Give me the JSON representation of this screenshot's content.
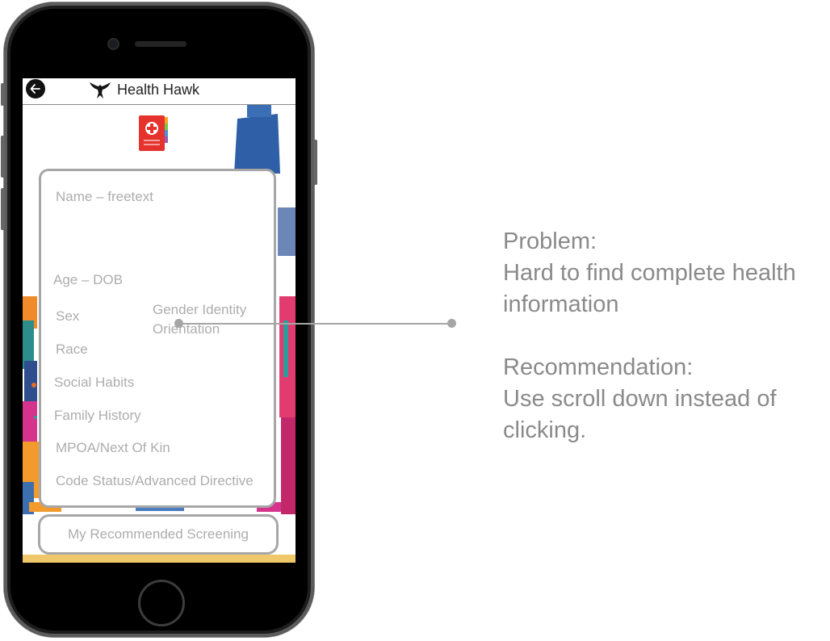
{
  "app": {
    "title": "Health Hawk"
  },
  "icons": {
    "back": "back-arrow-icon",
    "logo": "hawk-logo-icon",
    "record": "medical-record-icon"
  },
  "form": {
    "name": "Name – freetext",
    "age": "Age – DOB",
    "sex": "Sex",
    "gender_identity": "Gender Identity",
    "orientation": "Orientation",
    "race": "Race",
    "social_habits": "Social Habits",
    "family_history": "Family History",
    "mpoa": "MPOA/Next Of Kin",
    "code_status": "Code Status/Advanced Directive"
  },
  "screening_button": "My Recommended Screening",
  "annotation": {
    "problem_heading": "Problem:",
    "problem_line1": "Hard to find complete health",
    "problem_line2": "information",
    "recommendation_heading": "Recommendation:",
    "recommendation_line1": "Use scroll down instead of",
    "recommendation_line2": "clicking."
  },
  "colors": {
    "field_text": "#adadad",
    "card_border": "#a7a7a7",
    "annotation_text": "#8a8a8a",
    "record_red": "#e5322d"
  }
}
